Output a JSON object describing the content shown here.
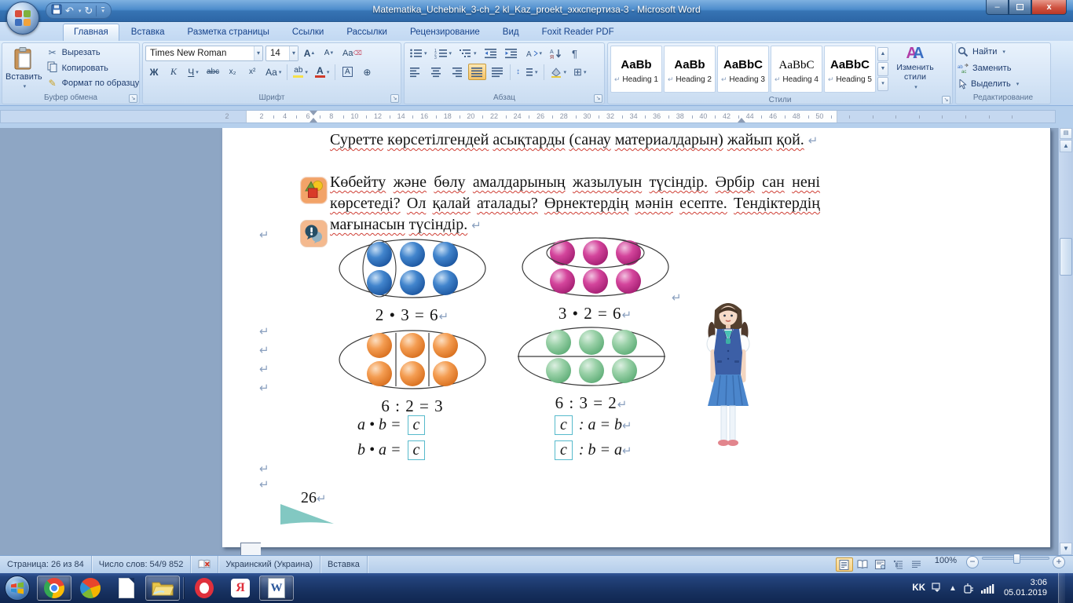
{
  "window": {
    "title": "Matematika_Uchebnik_3-ch_2 kl_Kaz_proekt_эхкспертиза-3 - Microsoft Word"
  },
  "tabs": [
    {
      "label": "Главная",
      "active": true
    },
    {
      "label": "Вставка"
    },
    {
      "label": "Разметка страницы"
    },
    {
      "label": "Ссылки"
    },
    {
      "label": "Рассылки"
    },
    {
      "label": "Рецензирование"
    },
    {
      "label": "Вид"
    },
    {
      "label": "Foxit Reader PDF"
    }
  ],
  "ribbon": {
    "clipboard": {
      "label": "Буфер обмена",
      "paste": "Вставить",
      "cut": "Вырезать",
      "copy": "Копировать",
      "format_painter": "Формат по образцу"
    },
    "font": {
      "label": "Шрифт",
      "name": "Times New Roman",
      "size": "14"
    },
    "paragraph": {
      "label": "Абзац"
    },
    "styles": {
      "label": "Стили",
      "change": "Изменить стили",
      "items": [
        {
          "sample": "AaBb",
          "name": "Heading 1"
        },
        {
          "sample": "AaBb",
          "name": "Heading 2"
        },
        {
          "sample": "AaBbC",
          "name": "Heading 3"
        },
        {
          "sample": "AaBbC",
          "name": "Heading 4",
          "serif": true
        },
        {
          "sample": "AaBbC",
          "name": "Heading 5"
        }
      ]
    },
    "editing": {
      "label": "Редактирование",
      "find": "Найти",
      "replace": "Заменить",
      "select": "Выделить"
    }
  },
  "ruler": {
    "margin_number": "2",
    "numbers": [
      "2",
      "4",
      "6",
      "8",
      "10",
      "12",
      "14",
      "16",
      "18",
      "20",
      "22",
      "24",
      "26",
      "28",
      "30",
      "32",
      "34",
      "36",
      "38",
      "40",
      "42",
      "44",
      "46",
      "48",
      "50"
    ]
  },
  "document": {
    "para1": "Суретте көрсетілгендей асықтарды (санау материалдарын) жайып қой.",
    "para2": "Көбейту және бөлу амалдарының жазылуын түсіндір. Әрбір сан нені көрсетеді? Ол қалай аталады? Өрнектердің мәнін есепте. Тендіктердің мағынасын түсіндір.",
    "diagrams": [
      {
        "caption": "2 • 3 = 6",
        "color": "#4285cd",
        "dark": "#1c56a0",
        "light": "#c6def5",
        "group": "column",
        "mark": true
      },
      {
        "caption": "3 • 2 = 6",
        "color": "#d4459c",
        "dark": "#a41f72",
        "light": "#f2c2e0",
        "group": "row",
        "mark": true
      },
      {
        "caption": "6 : 2 = 3",
        "color": "#f49d52",
        "dark": "#d86f1e",
        "light": "#fcdfc2",
        "group": "vlines",
        "mark": false
      },
      {
        "caption": "6 : 3 = 2",
        "color": "#9ad1a8",
        "dark": "#5fae78",
        "light": "#ddf0e2",
        "group": "hline",
        "mark": true
      }
    ],
    "formulas": [
      {
        "pre": "a • b = ",
        "box": "c",
        "post": "",
        "mark": false
      },
      {
        "pre": "",
        "box": "c",
        "post": " : a = b",
        "mark": true
      },
      {
        "pre": "b • a = ",
        "box": "c",
        "post": "",
        "mark": false
      },
      {
        "pre": "",
        "box": "c",
        "post": " : b = a",
        "mark": true
      }
    ],
    "page_number": "26"
  },
  "statusbar": {
    "page": "Страница: 26 из 84",
    "words": "Число слов: 54/9 852",
    "language": "Украинский (Украина)",
    "mode": "Вставка",
    "zoom": "100%"
  },
  "taskbar": {
    "language": "KK",
    "time": "3:06",
    "date": "05.01.2019",
    "items": [
      {
        "name": "chrome-icon",
        "pressed": true
      },
      {
        "name": "color-ball-icon",
        "pressed": false
      },
      {
        "name": "notepad-icon",
        "pressed": false
      },
      {
        "name": "explorer-icon",
        "pressed": true
      },
      {
        "name": "opera-icon",
        "pressed": false
      },
      {
        "name": "yandex-icon",
        "pressed": false
      },
      {
        "name": "word-icon",
        "pressed": true
      }
    ]
  },
  "icons": {
    "pilcrow": "↵",
    "launcher": "↘",
    "dropdown": "▾",
    "cut": "✂",
    "painter": "✎",
    "bold": "Ж",
    "italic": "К",
    "underline": "Ч",
    "strike": "abc",
    "subscript": "x₂",
    "superscript": "x²",
    "case": "Aa",
    "highlight": "ab",
    "font_color": "A",
    "char_border": "A",
    "enclose": "⊕",
    "grow": "А",
    "shrink": "А",
    "up": "▲",
    "down": "▼",
    "sort_a": "А",
    "sort_z": "Я",
    "marks": "¶",
    "spacing": "↕",
    "borders": "⊞",
    "undo": "↶",
    "redo": "↻",
    "minimize": "–",
    "close": "x",
    "zoom_out": "−",
    "zoom_in": "+",
    "word_letter": "W",
    "yandex_letter": "Я"
  }
}
